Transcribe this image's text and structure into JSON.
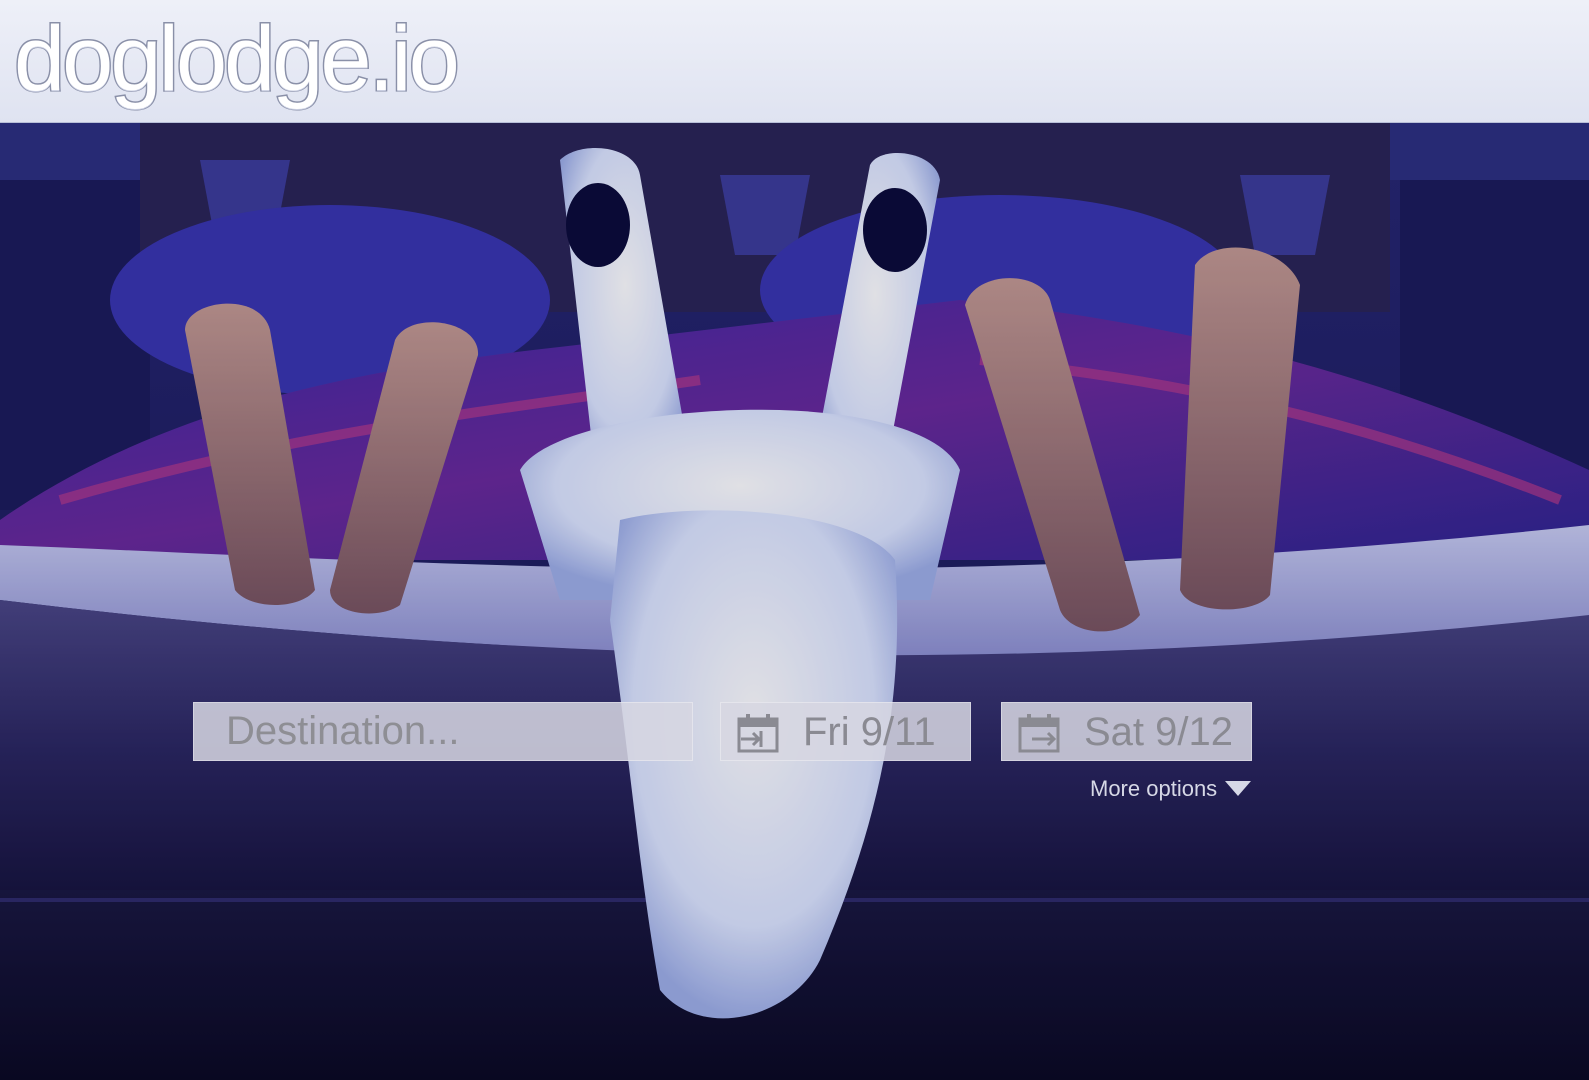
{
  "brand": {
    "logo_text": "doglodge.io"
  },
  "hero": {
    "image_alt": ""
  },
  "search": {
    "destination_placeholder": "Destination...",
    "destination_value": "",
    "checkin_label": "Fri 9/11",
    "checkout_label": "Sat 9/12",
    "more_options_label": "More options",
    "icons": {
      "checkin": "calendar-checkin-icon",
      "checkout": "calendar-checkout-icon",
      "more_options": "triangle-down-icon"
    }
  },
  "colors": {
    "header_bg": "#e6e9f4",
    "field_bg": "#d6d6e2",
    "field_text": "#8a8a92",
    "link_text": "#d6d8e6",
    "scene_dark": "#0d0d2e",
    "blanket_purple": "#3b2aa0"
  }
}
